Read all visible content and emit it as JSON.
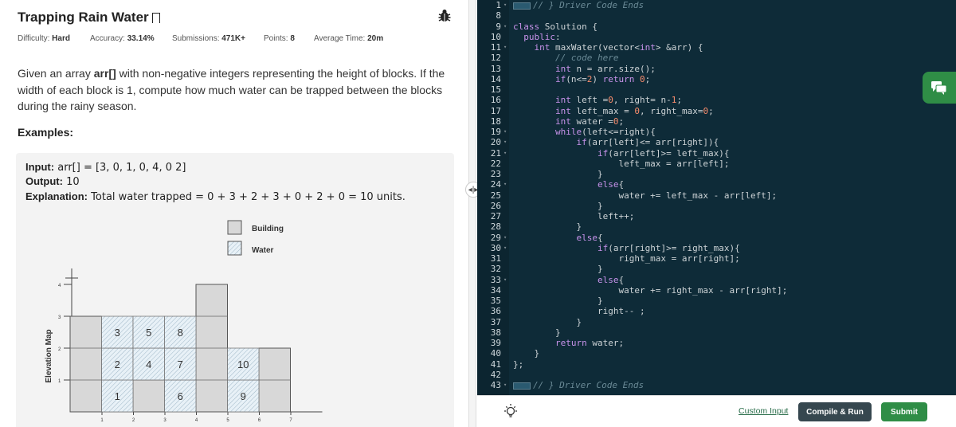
{
  "problem": {
    "title": "Trapping Rain Water",
    "meta": {
      "difficulty_label": "Difficulty:",
      "difficulty": "Hard",
      "accuracy_label": "Accuracy:",
      "accuracy": "33.14%",
      "submissions_label": "Submissions:",
      "submissions": "471K+",
      "points_label": "Points:",
      "points": "8",
      "avg_time_label": "Average Time:",
      "avg_time": "20m"
    },
    "description_pre": "Given an array ",
    "description_arr": "arr[]",
    "description_post": " with non-negative integers representing the height of blocks. If the width of each block is 1, compute how much water can be trapped between the blocks during the rainy season.",
    "examples_heading": "Examples:",
    "example": {
      "input_label": "Input:",
      "input_value": "arr[] = [3, 0, 1, 0, 4, 0 2]",
      "output_label": "Output:",
      "output_value": "10",
      "explanation_label": "Explanation:",
      "explanation_value": "Total water trapped = 0 + 3 + 2 + 3 + 0 + 2 + 0 = 10 units."
    },
    "figure": {
      "legend_building": "Building",
      "legend_water": "Water",
      "ylabel": "Elevation Map",
      "yticks": [
        "1",
        "2",
        "3",
        "4"
      ],
      "xticks": [
        "1",
        "2",
        "3",
        "4",
        "5",
        "6",
        "7"
      ],
      "heights": [
        3,
        0,
        1,
        0,
        4,
        0,
        2
      ],
      "water_cells": [
        {
          "col": 1,
          "row": 1,
          "label": "1"
        },
        {
          "col": 1,
          "row": 2,
          "label": "2"
        },
        {
          "col": 1,
          "row": 3,
          "label": "3"
        },
        {
          "col": 2,
          "row": 2,
          "label": "4"
        },
        {
          "col": 2,
          "row": 3,
          "label": "5"
        },
        {
          "col": 3,
          "row": 1,
          "label": "6"
        },
        {
          "col": 3,
          "row": 2,
          "label": "7"
        },
        {
          "col": 3,
          "row": 3,
          "label": "8"
        },
        {
          "col": 5,
          "row": 1,
          "label": "9"
        },
        {
          "col": 5,
          "row": 2,
          "label": "10"
        }
      ]
    }
  },
  "editor": {
    "lines": [
      {
        "n": "1",
        "fold": true,
        "code": "[[cm]]// } Driver Code Ends"
      },
      {
        "n": "8",
        "fold": false,
        "code": ""
      },
      {
        "n": "9",
        "fold": true,
        "code": "[[kw]]class[[/]] Solution {"
      },
      {
        "n": "10",
        "fold": false,
        "code": "  [[kw]]public[[/]]:"
      },
      {
        "n": "11",
        "fold": true,
        "code": "    [[kw]]int[[/]] maxWater(vector<[[kw]]int[[/]]> &arr) {"
      },
      {
        "n": "12",
        "fold": false,
        "code": "        [[cm]]// code here"
      },
      {
        "n": "13",
        "fold": false,
        "code": "        [[kw]]int[[/]] n = arr.size();"
      },
      {
        "n": "14",
        "fold": false,
        "code": "        [[kw]]if[[/]](n<=[[num]]2[[/]]) [[kw]]return[[/]] [[num]]0[[/]];"
      },
      {
        "n": "15",
        "fold": false,
        "code": ""
      },
      {
        "n": "16",
        "fold": false,
        "code": "        [[kw]]int[[/]] left =[[num]]0[[/]], right= n-[[num]]1[[/]];"
      },
      {
        "n": "17",
        "fold": false,
        "code": "        [[kw]]int[[/]] left_max = [[num]]0[[/]], right_max=[[num]]0[[/]];"
      },
      {
        "n": "18",
        "fold": false,
        "code": "        [[kw]]int[[/]] water =[[num]]0[[/]];"
      },
      {
        "n": "19",
        "fold": true,
        "code": "        [[kw]]while[[/]](left<=right){"
      },
      {
        "n": "20",
        "fold": true,
        "code": "            [[kw]]if[[/]](arr[left]<= arr[right]){"
      },
      {
        "n": "21",
        "fold": true,
        "code": "                [[kw]]if[[/]](arr[left]>= left_max){"
      },
      {
        "n": "22",
        "fold": false,
        "code": "                    left_max = arr[left];"
      },
      {
        "n": "23",
        "fold": false,
        "code": "                }"
      },
      {
        "n": "24",
        "fold": true,
        "code": "                [[kw]]else[[/]]{"
      },
      {
        "n": "25",
        "fold": false,
        "code": "                    water += left_max - arr[left];"
      },
      {
        "n": "26",
        "fold": false,
        "code": "                }"
      },
      {
        "n": "27",
        "fold": false,
        "code": "                left++;"
      },
      {
        "n": "28",
        "fold": false,
        "code": "            }"
      },
      {
        "n": "29",
        "fold": true,
        "code": "            [[kw]]else[[/]]{"
      },
      {
        "n": "30",
        "fold": true,
        "code": "                [[kw]]if[[/]](arr[right]>= right_max){"
      },
      {
        "n": "31",
        "fold": false,
        "code": "                    right_max = arr[right];"
      },
      {
        "n": "32",
        "fold": false,
        "code": "                }"
      },
      {
        "n": "33",
        "fold": true,
        "code": "                [[kw]]else[[/]]{"
      },
      {
        "n": "34",
        "fold": false,
        "code": "                    water += right_max - arr[right];"
      },
      {
        "n": "35",
        "fold": false,
        "code": "                }"
      },
      {
        "n": "36",
        "fold": false,
        "code": "                right-- ;"
      },
      {
        "n": "37",
        "fold": false,
        "code": "            }"
      },
      {
        "n": "38",
        "fold": false,
        "code": "        }"
      },
      {
        "n": "39",
        "fold": false,
        "code": "        [[kw]]return[[/]] water;"
      },
      {
        "n": "40",
        "fold": false,
        "code": "    }"
      },
      {
        "n": "41",
        "fold": false,
        "code": "};"
      },
      {
        "n": "42",
        "fold": false,
        "code": ""
      },
      {
        "n": "43",
        "fold": true,
        "code": "[[cm]]// } Driver Code Ends"
      }
    ]
  },
  "actions": {
    "custom_input": "Custom Input",
    "compile_run": "Compile & Run",
    "submit": "Submit"
  },
  "colors": {
    "accent_green": "#2f8d46",
    "editor_bg": "#0e2b38",
    "compile_bg": "#36474f"
  }
}
